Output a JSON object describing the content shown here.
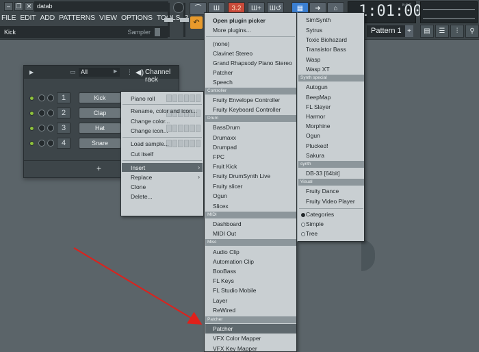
{
  "window": {
    "project_name": "datab",
    "controls": [
      "minimize",
      "restore",
      "close"
    ]
  },
  "menubar": [
    "FILE",
    "EDIT",
    "ADD",
    "PATTERNS",
    "VIEW",
    "OPTIONS",
    "TOOLS",
    "?"
  ],
  "hint_bar": {
    "left": "Kick",
    "right": "Sampler"
  },
  "toolbar": {
    "pat_song": "3.2",
    "time": "1:01:00",
    "time_label": "B:S:T",
    "pattern": "Pattern 1",
    "pattern_add": "+"
  },
  "channel_rack": {
    "filter": "All",
    "title": "Channel rack",
    "add_label": "+",
    "channels": [
      {
        "num": "1",
        "name": "Kick"
      },
      {
        "num": "2",
        "name": "Clap"
      },
      {
        "num": "3",
        "name": "Hat"
      },
      {
        "num": "4",
        "name": "Snare"
      }
    ]
  },
  "context_menu": {
    "items": [
      {
        "label": "Piano roll"
      },
      {
        "label": "Rename, color and icon..."
      },
      {
        "label": "Change color..."
      },
      {
        "label": "Change icon..."
      },
      {
        "label": "Load sample..."
      },
      {
        "label": "Cut itself"
      },
      {
        "label": "Insert",
        "submenu": true,
        "highlighted": true
      },
      {
        "label": "Replace",
        "submenu": true
      },
      {
        "label": "Clone"
      },
      {
        "label": "Delete..."
      }
    ]
  },
  "plugin_menu": {
    "col1": {
      "top": [
        "Open plugin picker",
        "More plugins..."
      ],
      "none": "(none)",
      "generators": [
        "Clavinet Stereo",
        "Grand Rhapsody Piano Stereo",
        "Patcher",
        "Speech"
      ],
      "controller_header": "Controller",
      "controller": [
        "Fruity Envelope Controller",
        "Fruity Keyboard Controller"
      ],
      "drum_header": "Drum",
      "drum": [
        "BassDrum",
        "Drumaxx",
        "Drumpad",
        "FPC",
        "Fruit Kick",
        "Fruity DrumSynth Live",
        "Fruity slicer",
        "Ogun",
        "Slicex"
      ],
      "midi_header": "MIDI",
      "midi": [
        "Dashboard",
        "MIDI Out"
      ],
      "misc_header": "Misc",
      "misc": [
        "Audio Clip",
        "Automation Clip",
        "BooBass",
        "FL Keys",
        "FL Studio Mobile",
        "Layer",
        "ReWired"
      ],
      "patcher_header": "Patcher",
      "patcher": [
        "Patcher",
        "VFX Color Mapper",
        "VFX Key Mapper"
      ]
    },
    "col2": {
      "top": [
        "SimSynth",
        "Sytrus",
        "Toxic Biohazard",
        "Transistor Bass",
        "Wasp",
        "Wasp XT"
      ],
      "synth_special_header": "Synth special",
      "synth_special": [
        "Autogun",
        "BeepMap",
        "FL Slayer",
        "Harmor",
        "Morphine",
        "Ogun",
        "Plucked!",
        "Sakura"
      ],
      "synth_header": "synth",
      "synth": [
        "DB-33 [64bit]"
      ],
      "visual_header": "Visual",
      "visual": [
        "Fruity Dance",
        "Fruity Video Player"
      ],
      "view_options": [
        {
          "label": "Categories",
          "selected": true
        },
        {
          "label": "Simple",
          "selected": false
        },
        {
          "label": "Tree",
          "selected": false
        }
      ]
    }
  },
  "colors": {
    "annotation_arrow": "#e0201a",
    "highlight": "#5e686d",
    "menu_bg": "#c9cfd2"
  }
}
